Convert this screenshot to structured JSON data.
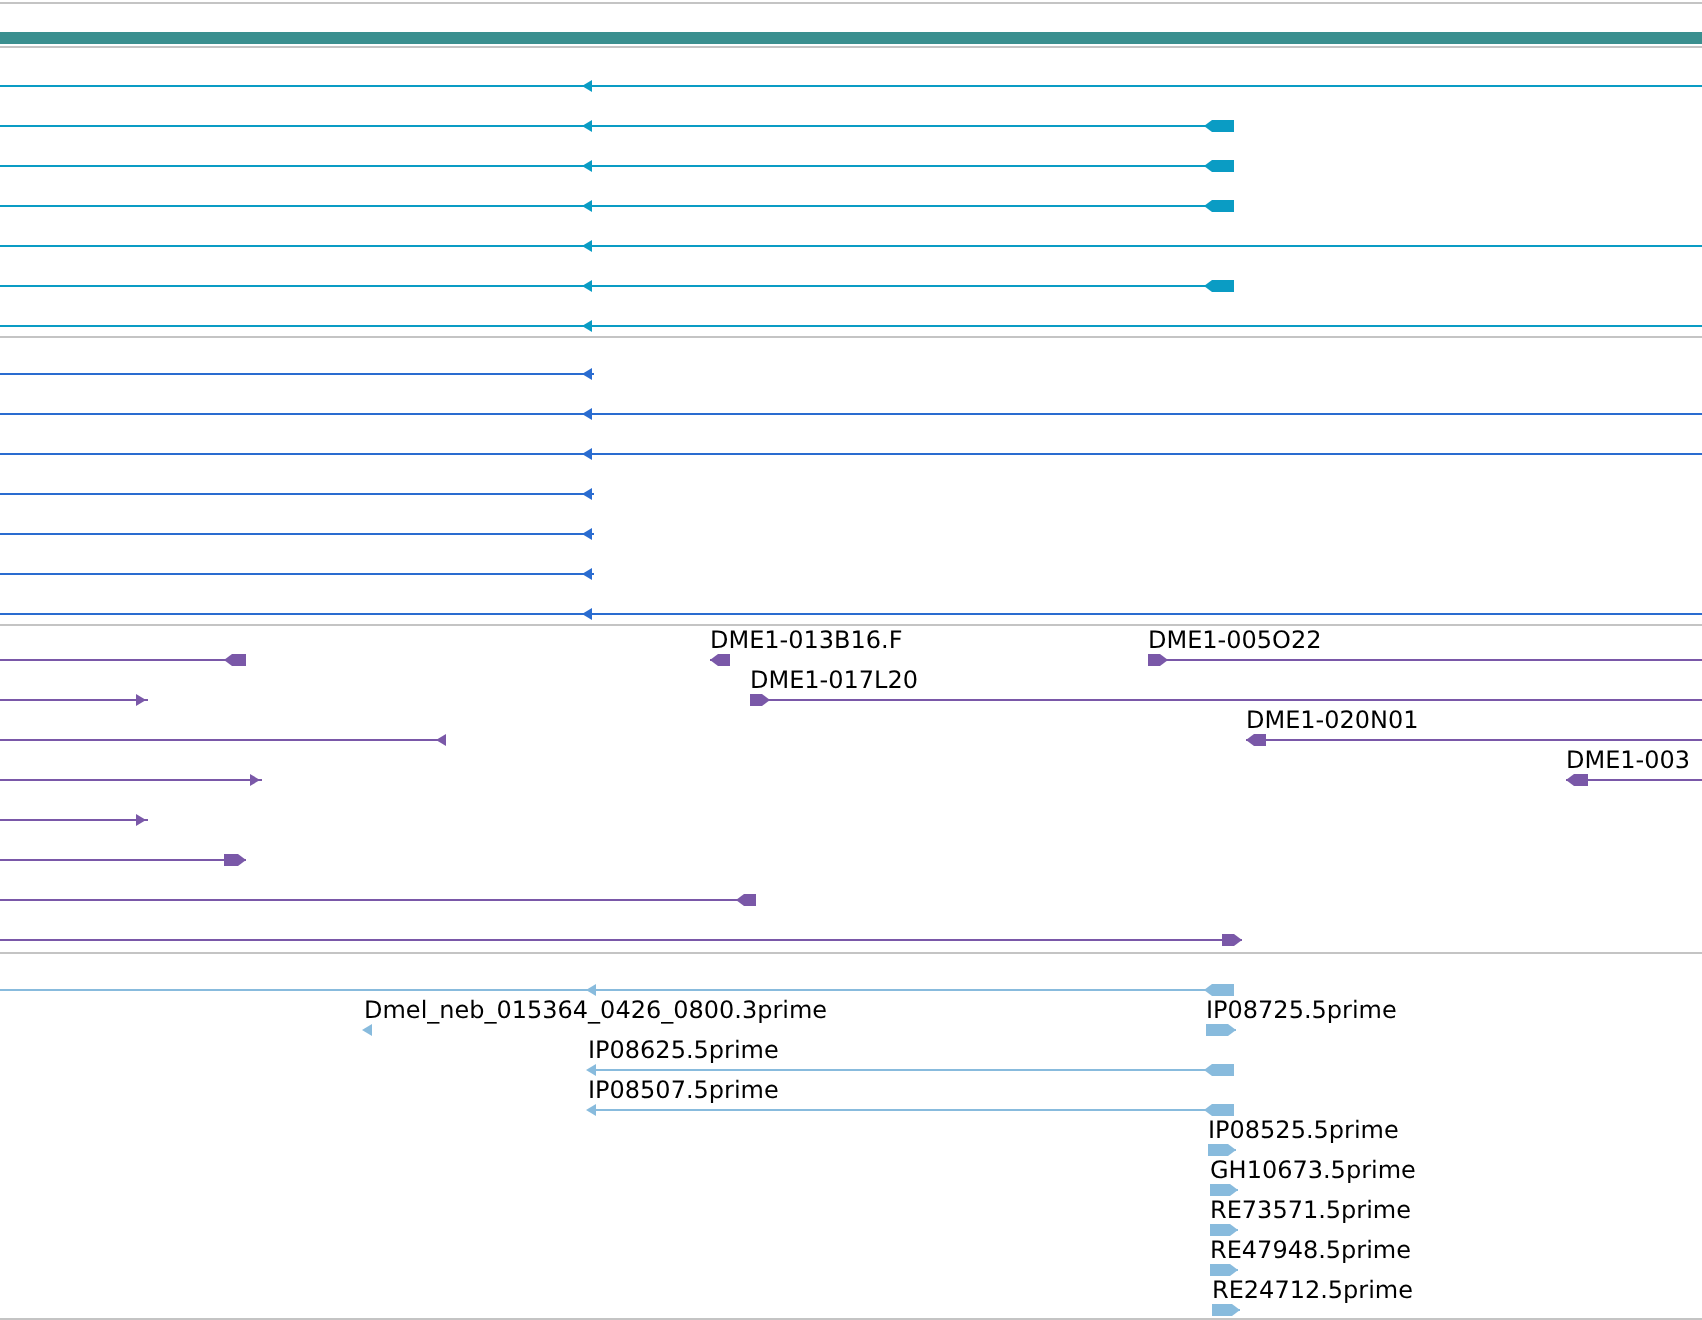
{
  "tracks": [
    {
      "kind": "band",
      "color": "#3a8f8f"
    },
    {
      "kind": "features",
      "color": "#0a9cc4",
      "rows": [
        [
          {
            "reverse": true
          }
        ],
        [
          {
            "reverse": true
          }
        ],
        [
          {
            "reverse": true
          }
        ],
        [
          {
            "reverse": true
          }
        ],
        [
          {
            "reverse": true
          }
        ],
        [
          {
            "reverse": true
          }
        ],
        [
          {
            "reverse": true
          }
        ]
      ]
    },
    {
      "kind": "features",
      "color": "#2a6cd0",
      "rows": [
        [
          {
            "reverse": true
          }
        ],
        [
          {
            "reverse": true
          }
        ],
        [
          {
            "reverse": true
          }
        ],
        [
          {
            "reverse": true
          }
        ],
        [
          {
            "reverse": true
          }
        ],
        [
          {
            "reverse": true
          }
        ],
        [
          {
            "reverse": true
          }
        ]
      ]
    },
    {
      "kind": "features",
      "color": "#7a58a8",
      "rows": [
        [
          {
            "reverse": true
          },
          {
            "reverse": true,
            "label": "DME1-013B16.F"
          },
          {
            "reverse": false,
            "label": "DME1-005O22"
          }
        ],
        [
          {
            "reverse": false
          },
          {
            "reverse": false,
            "label": "DME1-017L20"
          }
        ],
        [
          {
            "reverse": true
          },
          {
            "reverse": true,
            "label": "DME1-020N01"
          }
        ],
        [
          {
            "reverse": false
          },
          {
            "reverse": true,
            "label": "DME1-003"
          }
        ],
        [
          {
            "reverse": false
          }
        ],
        [
          {
            "reverse": false
          }
        ],
        [
          {
            "reverse": true
          }
        ],
        [
          {
            "reverse": false
          }
        ]
      ]
    },
    {
      "kind": "features",
      "color": "#88bbdd",
      "rows": [
        [
          {
            "reverse": true
          }
        ],
        [
          {
            "reverse": true,
            "label": "Dmel_neb_015364_0426_0800.3prime"
          },
          {
            "reverse": false,
            "label": "IP08725.5prime"
          }
        ],
        [
          {
            "reverse": true,
            "label": "IP08625.5prime"
          }
        ],
        [
          {
            "reverse": true,
            "label": "IP08507.5prime"
          }
        ],
        [
          {
            "reverse": false,
            "label": "IP08525.5prime"
          }
        ],
        [
          {
            "reverse": false,
            "label": "GH10673.5prime"
          }
        ],
        [
          {
            "reverse": false,
            "label": "RE73571.5prime"
          }
        ],
        [
          {
            "reverse": false,
            "label": "RE47948.5prime"
          }
        ],
        [
          {
            "reverse": false,
            "label": "RE24712.5prime"
          }
        ]
      ]
    }
  ]
}
